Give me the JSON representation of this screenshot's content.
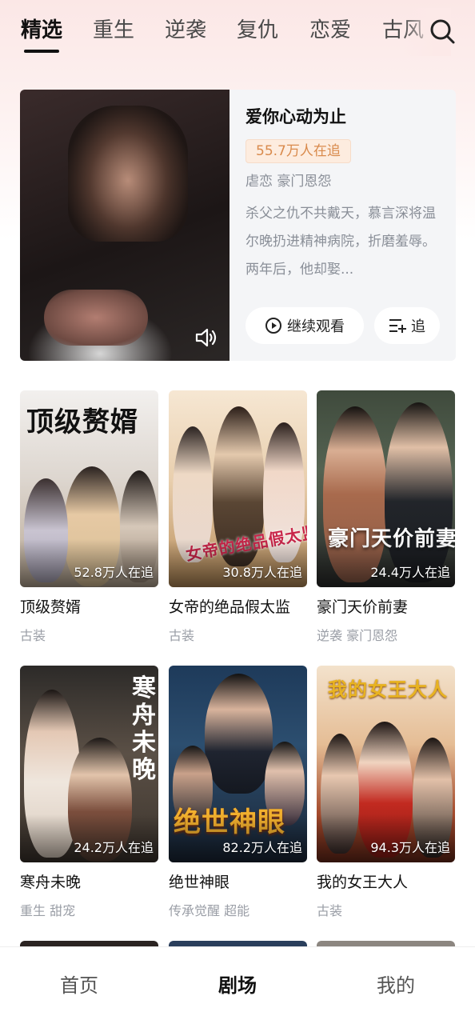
{
  "tabs": [
    {
      "label": "精选",
      "active": true
    },
    {
      "label": "重生"
    },
    {
      "label": "逆袭"
    },
    {
      "label": "复仇"
    },
    {
      "label": "恋爱"
    },
    {
      "label": "古风"
    }
  ],
  "search_icon": "search-icon",
  "featured": {
    "title": "爱你心动为止",
    "followers": "55.7万人在追",
    "tags": "虐恋 豪门恩怨",
    "description": "杀父之仇不共戴天，慕言深将温尔晚扔进精神病院，折磨羞辱。 两年后，他却娶...",
    "watch_label": "继续观看",
    "follow_label": "追",
    "sound_icon": "speaker-icon"
  },
  "grid": [
    {
      "title": "顶级赘婿",
      "poster_text": "顶级赘婿",
      "followers": "52.8万人在追",
      "tags": "古装"
    },
    {
      "title": "女帝的绝品假太监",
      "poster_text": "女帝的绝品假太监",
      "followers": "30.8万人在追",
      "tags": "古装"
    },
    {
      "title": "豪门天价前妻",
      "poster_text": "豪门天价前妻",
      "followers": "24.4万人在追",
      "tags": "逆袭 豪门恩怨"
    },
    {
      "title": "寒舟未晚",
      "poster_text": "寒舟未晚",
      "followers": "24.2万人在追",
      "tags": "重生 甜宠"
    },
    {
      "title": "绝世神眼",
      "poster_text": "绝世神眼",
      "followers": "82.2万人在追",
      "tags": "传承觉醒 超能"
    },
    {
      "title": "我的女王大人",
      "poster_text": "我的女王大人",
      "followers": "94.3万人在追",
      "tags": "古装"
    }
  ],
  "bottom_nav": [
    {
      "label": "首页"
    },
    {
      "label": "剧场",
      "active": true
    },
    {
      "label": "我的"
    }
  ]
}
